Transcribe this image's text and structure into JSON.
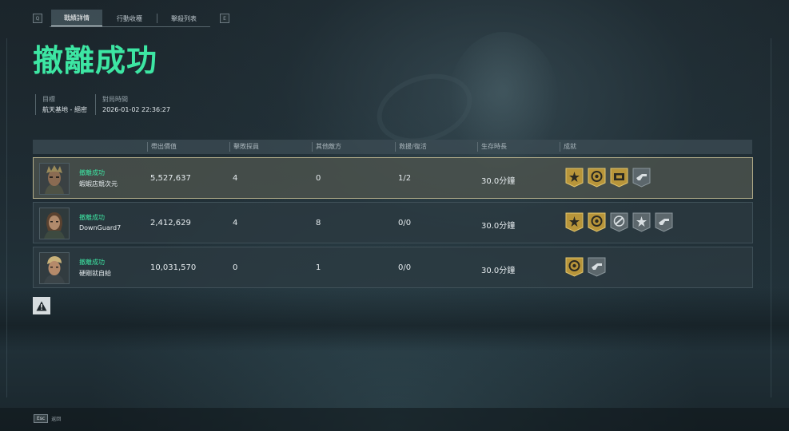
{
  "tabs": {
    "left_key": "Q",
    "right_key": "E",
    "items": [
      {
        "label": "戰績詳情",
        "active": true
      },
      {
        "label": "行動收穫",
        "active": false
      },
      {
        "label": "擊殺列表",
        "active": false
      }
    ]
  },
  "result_title": "撤離成功",
  "meta": {
    "target_label": "目標",
    "target_value": "航天基地 - 絕密",
    "time_label": "對局時間",
    "time_value": "2026-01-02 22:36:27"
  },
  "table": {
    "headers": [
      "帶出價值",
      "擊敗探員",
      "其他敵方",
      "救援/復活",
      "生存時長",
      "成就"
    ],
    "rows": [
      {
        "status": "撤離成功",
        "name": "蝦蝦店競次元",
        "value": "5,527,637",
        "agents": "4",
        "others": "0",
        "rescue": "1/2",
        "survival": "30.0分鐘",
        "avatar": "operator-mask-avatar",
        "achievements": [
          "gold-star-icon",
          "gold-medal-icon",
          "gold-card-icon",
          "silver-gun-icon"
        ],
        "highlight": true
      },
      {
        "status": "撤離成功",
        "name": "DownGuard7",
        "value": "2,412,629",
        "agents": "4",
        "others": "8",
        "rescue": "0/0",
        "survival": "30.0分鐘",
        "avatar": "operator-female-avatar",
        "achievements": [
          "gold-star-icon",
          "gold-medal-icon",
          "silver-tools-icon",
          "silver-star-icon",
          "silver-gun-icon"
        ],
        "highlight": false
      },
      {
        "status": "撤離成功",
        "name": "硬剛就自給",
        "value": "10,031,570",
        "agents": "0",
        "others": "1",
        "rescue": "0/0",
        "survival": "30.0分鐘",
        "avatar": "operator-blond-avatar",
        "achievements": [
          "gold-medal-icon",
          "silver-gun-icon"
        ],
        "highlight": false
      }
    ]
  },
  "footer": {
    "esc_key": "Esc",
    "back_label": "返回"
  },
  "colors": {
    "accent": "#3de6a3",
    "gold": "#b8953a",
    "silver": "#6f7b80"
  }
}
